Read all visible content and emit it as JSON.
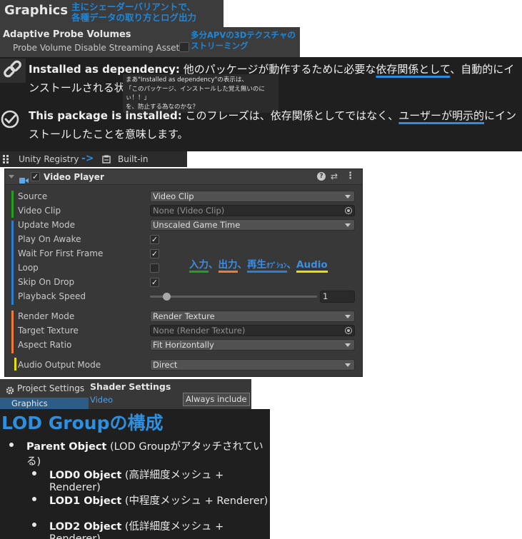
{
  "graphics_header": {
    "title": "Graphics",
    "note_line1": "主にシェーダーバリアントで、",
    "note_line2": "各種データの取り方とログ出力"
  },
  "apv": {
    "title": "Adaptive Probe Volumes",
    "row_label": "Probe Volume Disable Streaming Assets",
    "note_line1": "多分APVの3Dテクスチャの",
    "note_line2": "ストリーミング"
  },
  "dependency": {
    "dep_term": "Installed as dependency:",
    "dep_text_a": " 他のパッケージが動作するために必要な",
    "dep_text_ul": "依存関係として",
    "dep_text_b": "、自動的にインストールされる状況を指します。",
    "tooltip_line1": "まあ\"Installed as dependency\"の表示は、",
    "tooltip_line2": "「このパッケージ、インストールした覚え無いのにぃ！！」",
    "tooltip_line3": "を、防止する為なのかな？",
    "inst_term": "This package is installed:",
    "inst_text_a": " このフレーズは、依存関係としてではなく、",
    "inst_text_ul": "ユーザーが明示的",
    "inst_text_b": "にインストールしたことを意味します。"
  },
  "registry": {
    "source": "Unity Registry",
    "arrow": "->",
    "target": "Built-in"
  },
  "video_player": {
    "title": "Video Player",
    "rows": {
      "source_label": "Source",
      "source_value": "Video Clip",
      "clip_label": "Video Clip",
      "clip_value": "None (Video Clip)",
      "update_label": "Update Mode",
      "update_value": "Unscaled Game Time",
      "play_label": "Play On Awake",
      "wait_label": "Wait For First Frame",
      "loop_label": "Loop",
      "skip_label": "Skip On Drop",
      "speed_label": "Playback Speed",
      "speed_value": "1",
      "render_label": "Render Mode",
      "render_value": "Render Texture",
      "target_label": "Target Texture",
      "target_value": "None (Render Texture)",
      "aspect_label": "Aspect Ratio",
      "aspect_value": "Fit Horizontally",
      "audio_label": "Audio Output Mode",
      "audio_value": "Direct"
    },
    "checks": {
      "play_on_awake": true,
      "wait_for_first_frame": true,
      "loop": false,
      "skip_on_drop": true
    },
    "playback_speed_fraction": 0.1,
    "legend": {
      "input": "入力",
      "sep1": "、",
      "output": "出力",
      "sep2": "、",
      "playback": "再生",
      "option": "ｵﾌﾟｼｮﾝ",
      "sep3": "、",
      "audio": "Audio"
    },
    "colors": {
      "input": "#1fa31f",
      "output": "#f07a3a",
      "playback": "#2a7fd0",
      "audio": "#e8e000"
    }
  },
  "project_settings": {
    "title": "Project Settings",
    "selected": "Graphics"
  },
  "shader_settings": {
    "title": "Shader Settings",
    "video_label": "Video",
    "always_include": "Always include"
  },
  "lod": {
    "title": "LOD Groupの構成",
    "parent_bold": "Parent Object",
    "parent_text": " (LOD Groupがアタッチされている)",
    "items": [
      {
        "bold": "LOD0 Object",
        "text": " (高詳細度メッシュ + Renderer)"
      },
      {
        "bold": "LOD1 Object",
        "text": " (中程度メッシュ + Renderer)"
      },
      {
        "bold": "LOD2 Object",
        "text": " (低詳細度メッシュ + Renderer)"
      }
    ]
  }
}
